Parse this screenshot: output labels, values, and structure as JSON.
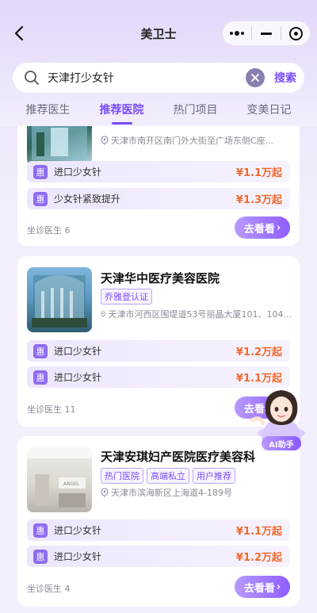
{
  "nav": {
    "title": "美卫士"
  },
  "search": {
    "query": "天津打少女针",
    "button": "搜索"
  },
  "tabs": [
    {
      "label": "推荐医生"
    },
    {
      "label": "推荐医院"
    },
    {
      "label": "热门项目"
    },
    {
      "label": "变美日记"
    }
  ],
  "hospitals": [
    {
      "name": "",
      "tags": [],
      "address": "天津市南开区南门外大街至广场东侧C座...",
      "projects": [
        {
          "badge": "惠",
          "name": "进口少女针",
          "price": "¥1.1万起"
        },
        {
          "badge": "惠",
          "name": "少女针紧致提升",
          "price": "¥1.3万起"
        }
      ],
      "doctors": "坐诊医生 6",
      "button": "去看看"
    },
    {
      "name": "天津华中医疗美容医院",
      "tags": [
        "乔雅登认证"
      ],
      "address": "天津市河西区围堤道53号丽晶大厦101、104...",
      "projects": [
        {
          "badge": "惠",
          "name": "进口少女针",
          "price": "¥1.2万起"
        },
        {
          "badge": "惠",
          "name": "进口少女针",
          "price": "¥1.1万起"
        }
      ],
      "doctors": "坐诊医生 11",
      "button": "去看看"
    },
    {
      "name": "天津安琪妇产医院医疗美容科",
      "tags": [
        "热门医院",
        "高端私立",
        "用户推荐"
      ],
      "address": "天津市滨海新区上海道4-189号",
      "projects": [
        {
          "badge": "惠",
          "name": "进口少女针",
          "price": "¥1.1万起"
        },
        {
          "badge": "惠",
          "name": "进口少女针",
          "price": "¥1.2万起"
        }
      ],
      "doctors": "坐诊医生 4",
      "button": "去看看"
    }
  ],
  "ai_assistant": {
    "label": "AI助手"
  },
  "colors": {
    "accent": "#7b4cff",
    "price": "#f06a2c",
    "header": "#e2d6fa"
  }
}
